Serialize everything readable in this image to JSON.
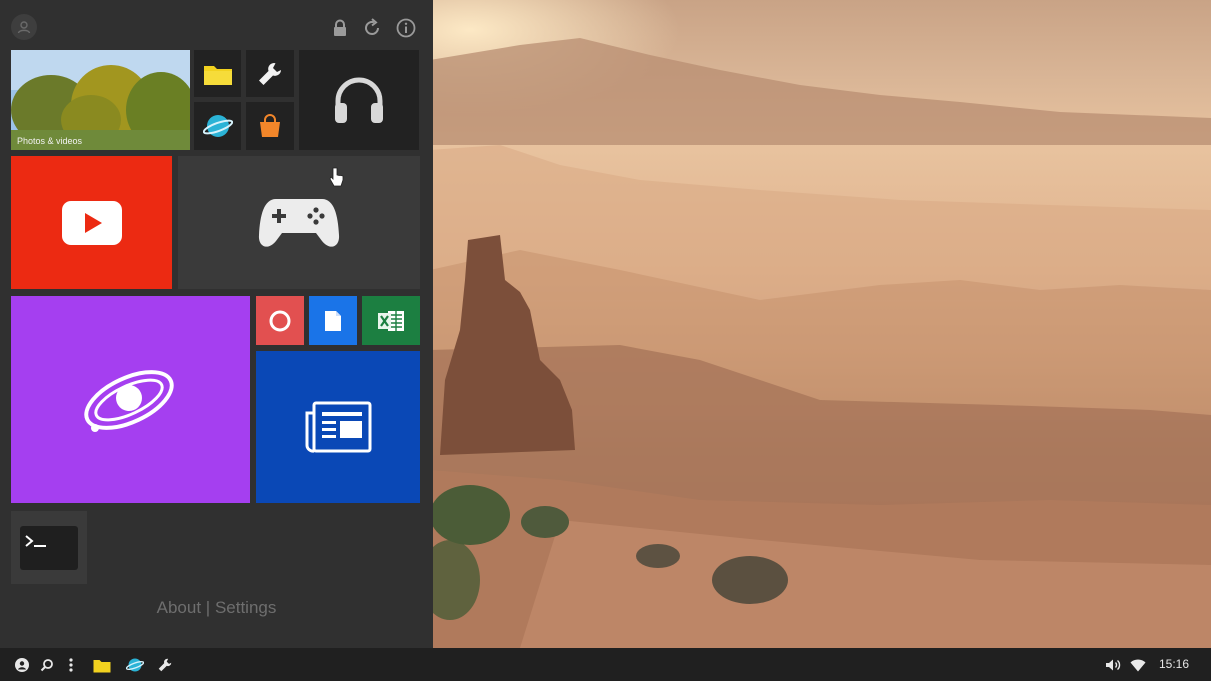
{
  "start_panel": {
    "header": {
      "avatar_icon": "user-avatar-icon",
      "lock_icon": "lock-icon",
      "refresh_icon": "refresh-icon",
      "info_icon": "info-icon"
    },
    "tiles": {
      "photos_label": "Photos & videos",
      "files_icon": "folder-icon",
      "settings_icon": "wrench-icon",
      "browser_icon": "planet-icon",
      "store_icon": "shopping-bag-icon",
      "music_icon": "headphones-icon",
      "youtube_icon": "youtube-play-icon",
      "games_icon": "gamepad-icon",
      "galaxy_icon": "orbit-icon",
      "record_icon": "record-icon",
      "docs_icon": "document-icon",
      "sheets_icon": "excel-icon",
      "news_icon": "newspaper-icon",
      "terminal_icon": "terminal-icon"
    },
    "footer": {
      "about_label": "About",
      "separator": " | ",
      "settings_label": "Settings"
    }
  },
  "taskbar": {
    "left_icons": [
      "start-icon",
      "search-icon",
      "more-icon",
      "folder-icon",
      "planet-icon",
      "wrench-icon"
    ],
    "volume_icon": "volume-icon",
    "wifi_icon": "wifi-icon",
    "clock": "15:16"
  },
  "colors": {
    "panel_bg": "#303030",
    "youtube_red": "#ec2a12",
    "galaxy_purple": "#a53ff0",
    "news_blue": "#0a48b6",
    "record_red": "#e25050",
    "docs_blue": "#1a74e8",
    "sheets_green": "#1c7f41"
  }
}
